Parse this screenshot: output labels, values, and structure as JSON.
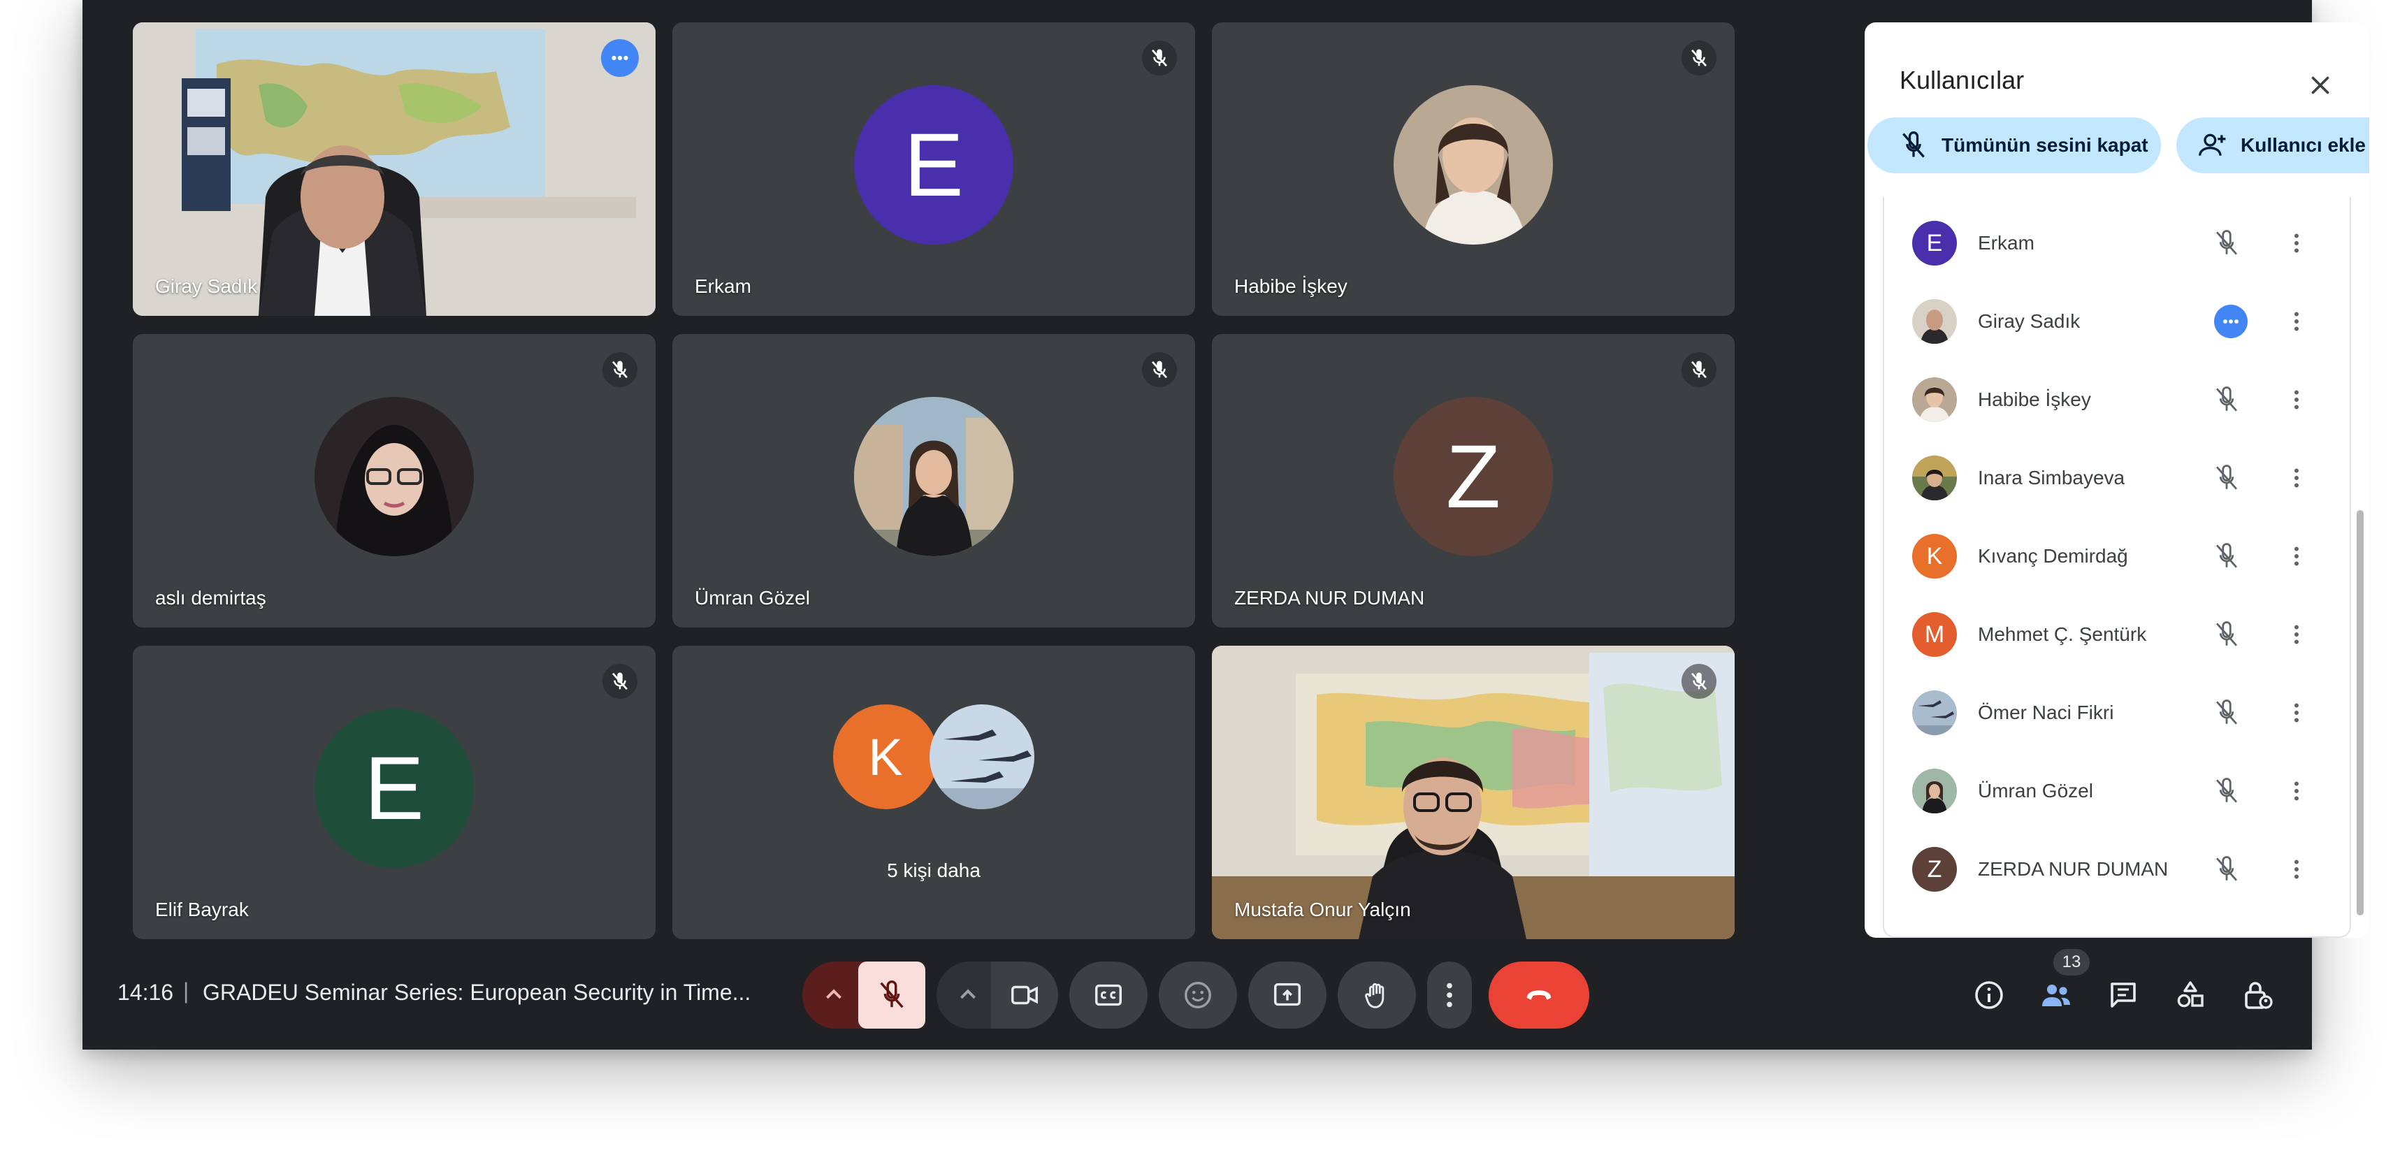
{
  "meeting": {
    "time": "14:16",
    "separator": "|",
    "title": "GRADEU Seminar Series: European Security in Time..."
  },
  "tiles": [
    {
      "name": "Giray Sadık",
      "type": "video",
      "active": true
    },
    {
      "name": "Erkam",
      "type": "initial",
      "initial": "E",
      "color": "#4a2fad",
      "muted": true
    },
    {
      "name": "Habibe İşkey",
      "type": "photo",
      "muted": true
    },
    {
      "name": "aslı demirtaş",
      "type": "photo",
      "muted": true
    },
    {
      "name": "Ümran Gözel",
      "type": "photo",
      "muted": true
    },
    {
      "name": "ZERDA NUR DUMAN",
      "type": "initial",
      "initial": "Z",
      "color": "#5d4037",
      "muted": true
    },
    {
      "name": "Elif Bayrak",
      "type": "initial",
      "initial": "E",
      "color": "#1e4d3a",
      "muted": true
    },
    {
      "name": "",
      "type": "more",
      "initial": "K",
      "label": "5 kişi daha"
    },
    {
      "name": "Mustafa Onur Yalçın",
      "type": "video",
      "muted": true
    }
  ],
  "panel": {
    "title": "Kullanıcılar",
    "mute_all_label": "Tümünün sesini kapat",
    "add_user_label": "Kullanıcı ekle",
    "participants": [
      {
        "name": "Erkam",
        "initial": "E",
        "color": "#4a2fad",
        "status": "muted"
      },
      {
        "name": "Giray Sadık",
        "initial": "",
        "color": "#8a8a8a",
        "status": "speaking"
      },
      {
        "name": "Habibe İşkey",
        "initial": "",
        "color": "#6b5a4a",
        "status": "muted"
      },
      {
        "name": "Inara Simbayeva",
        "initial": "",
        "color": "#7a6a3a",
        "status": "muted"
      },
      {
        "name": "Kıvanç Demirdağ",
        "initial": "K",
        "color": "#e8702a",
        "status": "muted"
      },
      {
        "name": "Mehmet Ç. Şentürk",
        "initial": "M",
        "color": "#e35d2f",
        "status": "muted"
      },
      {
        "name": "Ömer Naci Fikri",
        "initial": "",
        "color": "#8fa3b8",
        "status": "muted"
      },
      {
        "name": "Ümran Gözel",
        "initial": "",
        "color": "#5a6a5a",
        "status": "muted"
      },
      {
        "name": "ZERDA NUR DUMAN",
        "initial": "Z",
        "color": "#5d4037",
        "status": "muted"
      }
    ]
  },
  "controls": {
    "people_count": "13"
  },
  "colors": {
    "background": "#202124",
    "tile": "#3c4043",
    "accent_blue": "#8ab4f8",
    "end_call": "#ea4335",
    "mic_off_bg": "#f9dedc",
    "chip": "#c2e7ff"
  }
}
